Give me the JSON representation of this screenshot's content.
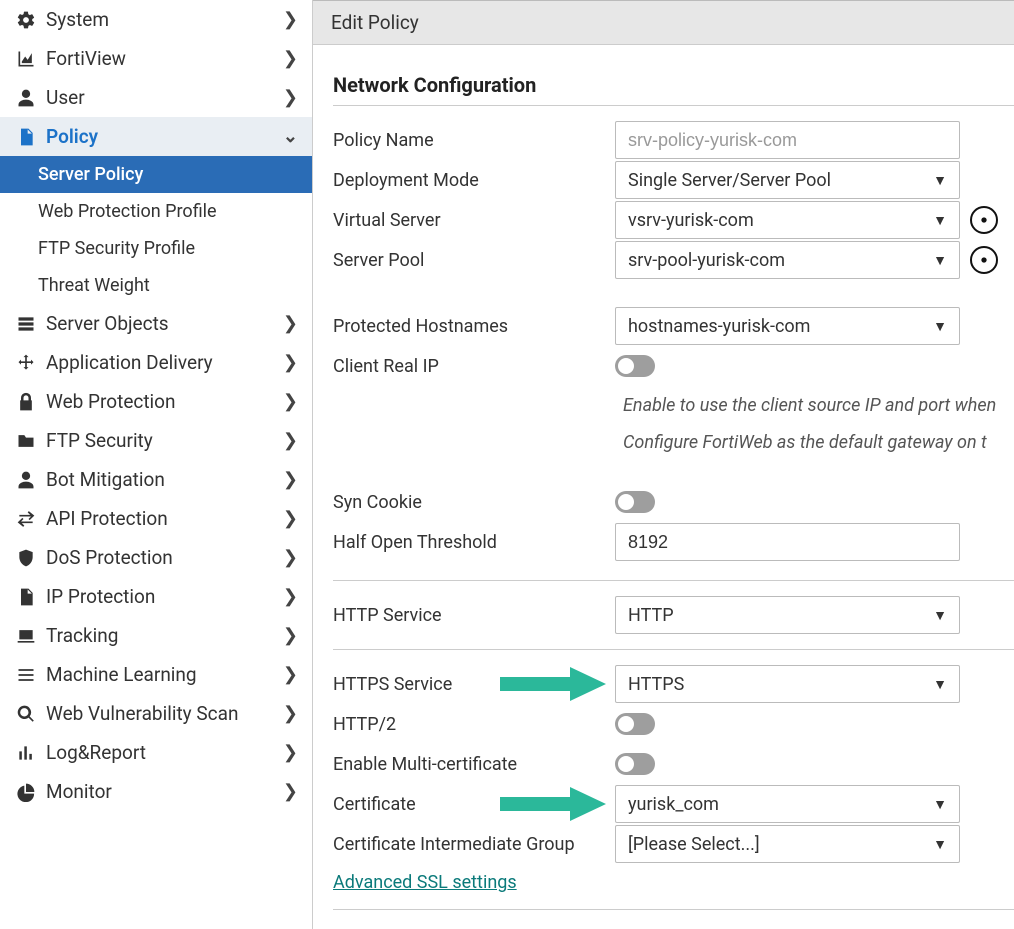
{
  "title": "Edit Policy",
  "nav": {
    "system": "System",
    "fortiview": "FortiView",
    "user": "User",
    "policy": "Policy",
    "server_policy": "Server Policy",
    "web_protection_profile": "Web Protection Profile",
    "ftp_security_profile": "FTP Security Profile",
    "threat_weight": "Threat Weight",
    "server_objects": "Server Objects",
    "application_delivery": "Application Delivery",
    "web_protection": "Web Protection",
    "ftp_security": "FTP Security",
    "bot_mitigation": "Bot Mitigation",
    "api_protection": "API Protection",
    "dos_protection": "DoS Protection",
    "ip_protection": "IP Protection",
    "tracking": "Tracking",
    "machine_learning": "Machine Learning",
    "web_vuln_scan": "Web Vulnerability Scan",
    "log_report": "Log&Report",
    "monitor": "Monitor"
  },
  "section": {
    "network_config": "Network Configuration"
  },
  "form": {
    "policy_name": {
      "label": "Policy Name",
      "placeholder": "srv-policy-yurisk-com"
    },
    "deployment_mode": {
      "label": "Deployment Mode",
      "value": "Single Server/Server Pool"
    },
    "virtual_server": {
      "label": "Virtual Server",
      "value": "vsrv-yurisk-com"
    },
    "server_pool": {
      "label": "Server Pool",
      "value": "srv-pool-yurisk-com"
    },
    "protected_hostnames": {
      "label": "Protected Hostnames",
      "value": "hostnames-yurisk-com"
    },
    "client_real_ip": {
      "label": "Client Real IP",
      "hint1": "Enable to use the client source IP and port when",
      "hint2": "Configure FortiWeb as the default gateway on t"
    },
    "syn_cookie": {
      "label": "Syn Cookie"
    },
    "half_open_threshold": {
      "label": "Half Open Threshold",
      "value": "8192"
    },
    "http_service": {
      "label": "HTTP Service",
      "value": "HTTP"
    },
    "https_service": {
      "label": "HTTPS Service",
      "value": "HTTPS"
    },
    "http2": {
      "label": "HTTP/2"
    },
    "enable_multi_cert": {
      "label": "Enable Multi-certificate"
    },
    "certificate": {
      "label": "Certificate",
      "value": "yurisk_com"
    },
    "cert_intermediate_group": {
      "label": "Certificate Intermediate Group",
      "value": "[Please Select...]"
    },
    "advanced_ssl": "Advanced SSL settings"
  }
}
